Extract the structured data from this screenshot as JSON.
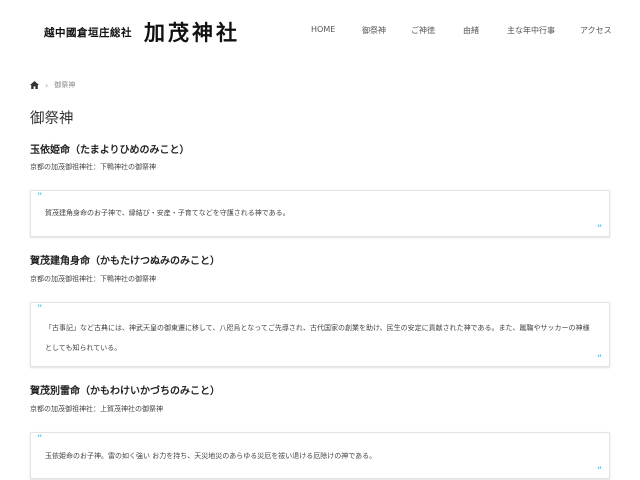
{
  "header": {
    "logo_sub": "越中國倉垣庄総社",
    "logo_main": "加茂神社",
    "nav": [
      "HOME",
      "御祭神",
      "ご神徳",
      "由緒",
      "主な年中行事",
      "アクセス"
    ]
  },
  "breadcrumb": {
    "home_icon": "home-icon",
    "current": "御祭神"
  },
  "page_title": "御祭神",
  "deities": [
    {
      "name": "玉依姫命（たまよりひめのみこと）",
      "shrine": "京都の加茂御祖神社：下鴨神社の御祭神",
      "quote": "賀茂建角身命のお子神で、縁結び・安産・子育てなどを守護される神である。"
    },
    {
      "name": "賀茂建角身命（かもたけつぬみのみこと）",
      "shrine": "京都の加茂御祖神社：下鴨神社の御祭神",
      "quote": "「古事記」など古典には、神武天皇の御東遷に移して、八咫烏となってご先導され、古代国家の創業を助け、民生の安定に貢献された神である。また、蹴鞠やサッカーの神様としても知られている。"
    },
    {
      "name": "賀茂別雷命（かもわけいかづちのみこと）",
      "shrine": "京都の加茂御祖神社：上賀茂神社の御祭神",
      "quote": "玉依姫命のお子神。雷の如く強い お力を持ち、天災地災のあらゆる災厄を祓い退ける厄除けの神である。"
    }
  ],
  "quote_marks": {
    "open": "”",
    "close": "”"
  },
  "colors": {
    "accent": "#4aaed8"
  }
}
